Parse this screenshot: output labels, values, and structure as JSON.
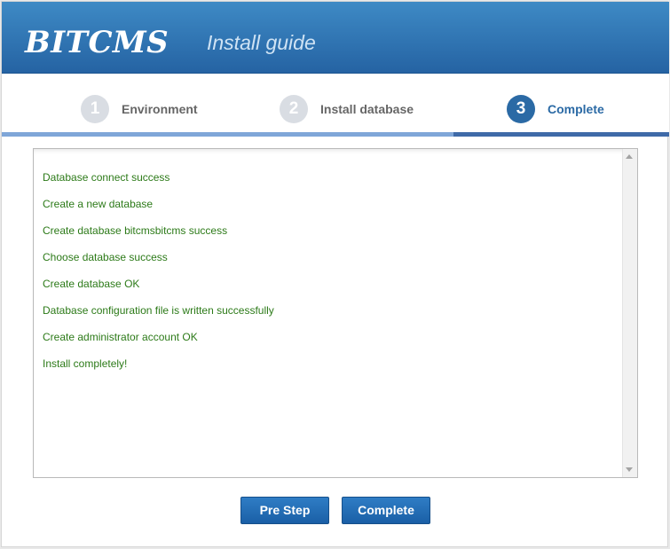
{
  "header": {
    "logo": "BITCMS",
    "subtitle": "Install guide"
  },
  "steps": [
    {
      "number": "1",
      "label": "Environment",
      "state": "done"
    },
    {
      "number": "2",
      "label": "Install database",
      "state": "done"
    },
    {
      "number": "3",
      "label": "Complete",
      "state": "active"
    }
  ],
  "log": {
    "lines": [
      "Database connect success",
      "Create a new database",
      "Create database bitcmsbitcms success",
      "Choose database success",
      "Create database OK",
      "Database configuration file is written successfully",
      "Create administrator account OK",
      "Install completely!"
    ],
    "text_color": "#2c7a18"
  },
  "buttons": {
    "prev_label": "Pre Step",
    "complete_label": "Complete"
  },
  "colors": {
    "header_bg": "#2f73b4",
    "accent": "#2b6aa5",
    "progress": "#7fa6d8"
  }
}
